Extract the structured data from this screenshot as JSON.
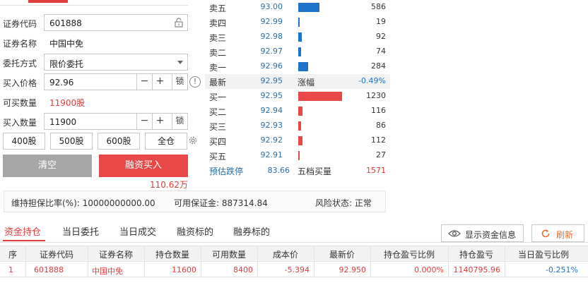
{
  "form": {
    "code_label": "证券代码",
    "code_value": "601888",
    "name_label": "证券名称",
    "name_value": "中国中免",
    "order_type_label": "委托方式",
    "order_type_value": "限价委托",
    "price_label": "买入价格",
    "price_value": "92.96",
    "minus": "−",
    "plus": "+",
    "lock": "锁",
    "buyable_label": "可买数量",
    "buyable_value": "11900股",
    "qty_label": "买入数量",
    "qty_value": "11900",
    "quick_qty": [
      "400股",
      "500股",
      "600股",
      "全仓"
    ],
    "clear_btn": "清空",
    "buy_btn": "融资买入",
    "amount": "110.62万",
    "info_icon": "!"
  },
  "orderbook": {
    "sell": [
      {
        "label": "卖五",
        "price": "93.00",
        "volume": "586",
        "bar": 0.476
      },
      {
        "label": "卖四",
        "price": "92.99",
        "volume": "19",
        "bar": 0.03
      },
      {
        "label": "卖三",
        "price": "92.98",
        "volume": "92",
        "bar": 0.075
      },
      {
        "label": "卖二",
        "price": "92.97",
        "volume": "74",
        "bar": 0.06
      },
      {
        "label": "卖一",
        "price": "92.96",
        "volume": "284",
        "bar": 0.231
      }
    ],
    "latest": {
      "label": "最新",
      "price": "92.95",
      "change_label": "涨幅",
      "change_value": "-0.49%"
    },
    "buy": [
      {
        "label": "买一",
        "price": "92.95",
        "volume": "1230",
        "bar": 1.0
      },
      {
        "label": "买二",
        "price": "92.94",
        "volume": "116",
        "bar": 0.094
      },
      {
        "label": "买三",
        "price": "92.93",
        "volume": "86",
        "bar": 0.07
      },
      {
        "label": "买四",
        "price": "92.92",
        "volume": "112",
        "bar": 0.091
      },
      {
        "label": "买五",
        "price": "92.91",
        "volume": "27",
        "bar": 0.03
      }
    ],
    "footer": {
      "est_label": "预估跌停",
      "est_value": "83.66",
      "total_label": "五档买量",
      "total_value": "1571"
    },
    "colors": {
      "sell": "#1e73c8",
      "buy": "#e84848"
    }
  },
  "infobar": {
    "ratio": "维持担保比率(%): 10000000000.00",
    "margin": "可用保证金: 887314.84",
    "risk": "风险状态: 正常"
  },
  "tabs": [
    "资金持仓",
    "当日委托",
    "当日成交",
    "融资标的",
    "融券标的"
  ],
  "actions": {
    "show_funds": "显示资金信息",
    "refresh": "刷新"
  },
  "table": {
    "headers": [
      "序",
      "证券代码",
      "证券名称",
      "持仓数量",
      "可用数量",
      "成本价",
      "最新价",
      "持仓盈亏比例",
      "持仓盈亏",
      "当日盈亏比例"
    ],
    "rows": [
      [
        "1",
        "601888",
        "中国中免",
        "11600",
        "8400",
        "-5.394",
        "92.950",
        "0.000%",
        "1140795.96",
        "-0.251%"
      ]
    ]
  }
}
